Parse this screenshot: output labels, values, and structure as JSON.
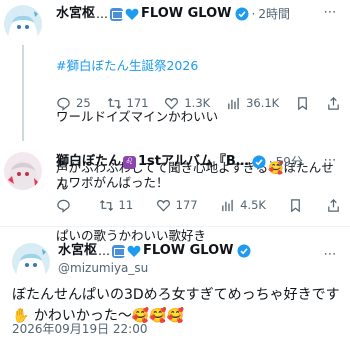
{
  "tweet1": {
    "author": "水宮枢",
    "time": "2時間",
    "brand": "FLOW GLOW",
    "hashtag": "#獅白ぼたん生誕祭2026",
    "lines": [
      "ワールドイズマインかわいい",
      "声がふわふわしてて聞き心地よすぎる🥰ぼたんせん",
      "ぱいの歌うかわいい歌好き"
    ],
    "replies": "25",
    "retweets": "171",
    "likes": "1.3K",
    "views": "36.1K"
  },
  "tweet2": {
    "author": "獅白ぼたん",
    "album": "1stアルバム『B…",
    "time": "59分",
    "text": "カワボがんばった！",
    "replies": "",
    "retweets": "11",
    "likes": "177",
    "views": "4.5K"
  },
  "tweet3": {
    "author": "水宮枢",
    "brand": "FLOW GLOW",
    "handle": "@mizumiya_su",
    "line1": "ぼたんせんぱいの3Dめろ女すぎてめっちゃ好きです",
    "line2": "✋ かわいかった〜🥰🥰🥰",
    "datetime": "2026年09月19日 22:00"
  },
  "ui": {
    "ellipsis": "…",
    "separator": "·",
    "more": "⋯"
  },
  "colors": {
    "accent": "#1d9bf0",
    "muted": "#536471",
    "text": "#0f1419"
  }
}
